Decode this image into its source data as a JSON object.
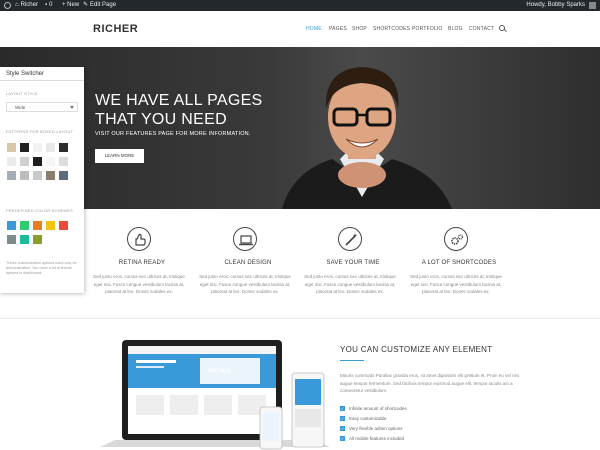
{
  "adminbar": {
    "site_name": "Richer",
    "comments_count": "0",
    "new_label": "+ New",
    "edit_label": "Edit Page",
    "greeting": "Howdy, Bobby Sparks"
  },
  "header": {
    "logo": "RICHER",
    "nav": [
      "HOME",
      "PAGES",
      "SHOP",
      "SHORTCODES",
      "PORTFOLIO",
      "BLOG",
      "CONTACT"
    ],
    "active_index": 0
  },
  "hero": {
    "title_line1": "WE HAVE ALL PAGES",
    "title_line2": "THAT YOU NEED",
    "subtitle": "VISIT OUR FEATURES PAGE FOR MORE INFORMATION.",
    "button": "LEARN MORE"
  },
  "switcher": {
    "title": "Style Switcher",
    "layout_label": "LAYOUT STYLE",
    "layout_value": "Wide",
    "patterns_label": "PATTERNS FOR BOXED LAYOUT",
    "colors_label": "PREDEFINED COLOR SCHEMES",
    "patterns": [
      "#d8c7a8",
      "#222222",
      "#f2f2f2",
      "#e8e8e8",
      "#2b2b2b",
      "#ececec",
      "#d0d0d0",
      "#1e1e1e",
      "#f5f5f5",
      "#dcdcdc",
      "#a7adb5",
      "#bdbdbd",
      "#c9c9c9",
      "#8a7f6e",
      "#5e6b7a"
    ],
    "colors": [
      "#3a9ad9",
      "#2ecc71",
      "#e67e22",
      "#f1c40f",
      "#e74c3c",
      "#7f8c8d",
      "#1abc9c",
      "#8e9c2e"
    ],
    "note": "These customization options used only for demonstration. You have a lot of theme options in dashboard."
  },
  "features": [
    {
      "icon": "thumbs-up-icon",
      "title": "RETINA READY",
      "text": "Sed justo eros, cursus nec ultrices at, tristique eget nisi. Fusce congue vestibulum lacinia at, placerat at leo. Donec sodales ex."
    },
    {
      "icon": "laptop-icon",
      "title": "CLEAN DESIGN",
      "text": "Sed justo eros, cursus nec ultrices at, tristique eget nisi. Fusce congue vestibulum lacinia at, placerat at leo. Donec sodales ex."
    },
    {
      "icon": "magic-wand-icon",
      "title": "SAVE YOUR TIME",
      "text": "Sed justo eros, cursus nec ultrices at, tristique eget nisi. Fusce congue vestibulum lacinia at, placerat at leo. Donec sodales ex."
    },
    {
      "icon": "gears-icon",
      "title": "A LOT OF SHORTCODES",
      "text": "Sed justo eros, cursus nec ultrices at, tristique eget nisi. Fusce congue vestibulum lacinia at, placerat at leo. Donec sodales ex."
    }
  ],
  "lower": {
    "title": "YOU CAN CUSTOMIZE ANY ELEMENT",
    "text": "Mauris commodo Parallax gravida eros, sit amet dignissim elit pretium et. Proin eu vel nisi augue tempor fermentum. Sed facilisis tempor euismod augue elit, tempor iaculis am a consectetur vestibulum.",
    "checks": [
      "Infinite amount of shortcodes",
      "Easy customizable",
      "Very flexible admin options",
      "All mobile features included"
    ]
  },
  "colors": {
    "accent": "#3a9ad9",
    "adminbar": "#23282d"
  }
}
